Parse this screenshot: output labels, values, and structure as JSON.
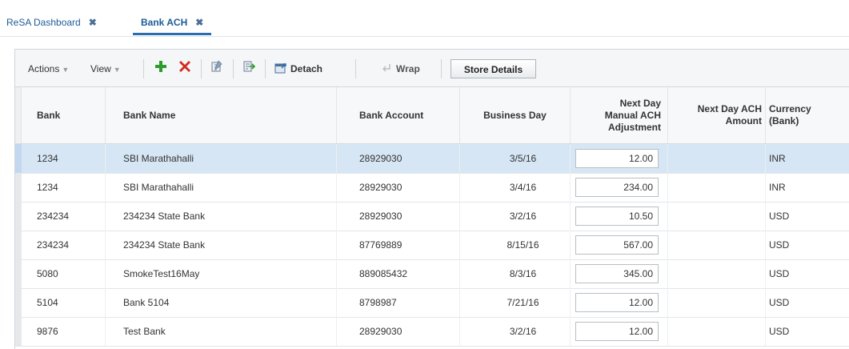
{
  "tabs": [
    {
      "label": "ReSA Dashboard",
      "close": "✖"
    },
    {
      "label": "Bank ACH",
      "close": "✖"
    }
  ],
  "toolbar": {
    "actions_label": "Actions",
    "view_label": "View",
    "detach_label": "Detach",
    "wrap_label": "Wrap",
    "store_details_label": "Store Details",
    "caret": "▼"
  },
  "colors": {
    "accent": "#2a6db0",
    "add_green": "#2e9b2e",
    "delete_red": "#d32a1f",
    "selected_row": "#d6e6f5"
  },
  "columns": {
    "bank": "Bank",
    "bank_name": "Bank Name",
    "bank_account": "Bank Account",
    "business_day": "Business Day",
    "next_day_adj": "Next Day Manual ACH Adjustment",
    "next_day_amount": "Next Day ACH Amount",
    "currency": "Currency (Bank)"
  },
  "rows": [
    {
      "bank": "1234",
      "bank_name": "SBI Marathahalli",
      "bank_account": "28929030",
      "business_day": "3/5/16",
      "adjustment": "12.00",
      "amount": "",
      "currency": "INR"
    },
    {
      "bank": "1234",
      "bank_name": "SBI Marathahalli",
      "bank_account": "28929030",
      "business_day": "3/4/16",
      "adjustment": "234.00",
      "amount": "",
      "currency": "INR"
    },
    {
      "bank": "234234",
      "bank_name": "234234 State Bank",
      "bank_account": "28929030",
      "business_day": "3/2/16",
      "adjustment": "10.50",
      "amount": "",
      "currency": "USD"
    },
    {
      "bank": "234234",
      "bank_name": "234234 State Bank",
      "bank_account": "87769889",
      "business_day": "8/15/16",
      "adjustment": "567.00",
      "amount": "",
      "currency": "USD"
    },
    {
      "bank": "5080",
      "bank_name": "SmokeTest16May",
      "bank_account": "889085432",
      "business_day": "8/3/16",
      "adjustment": "345.00",
      "amount": "",
      "currency": "USD"
    },
    {
      "bank": "5104",
      "bank_name": "Bank 5104",
      "bank_account": "8798987",
      "business_day": "7/21/16",
      "adjustment": "12.00",
      "amount": "",
      "currency": "USD"
    },
    {
      "bank": "9876",
      "bank_name": "Test Bank",
      "bank_account": "28929030",
      "business_day": "3/2/16",
      "adjustment": "12.00",
      "amount": "",
      "currency": "USD"
    }
  ]
}
